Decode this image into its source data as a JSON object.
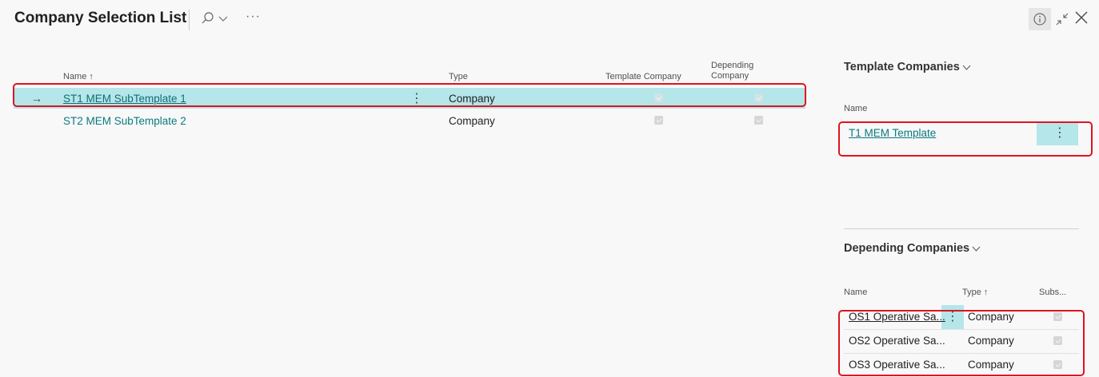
{
  "page": {
    "title": "Company Selection List",
    "icons": [
      "search-icon",
      "chevron-down-icon",
      "more-icon",
      "info-icon",
      "collapse-icon",
      "close-icon"
    ],
    "more_label": "···"
  },
  "colors": {
    "selection": "#b4e6ea",
    "link": "#0a7a80",
    "highlight_border": "#e0141e",
    "background": "#f8f8f8"
  },
  "main_list": {
    "columns": {
      "name": "Name",
      "name_sort": "↑",
      "type": "Type",
      "template_company": "Template Company",
      "depending_company_1": "Depending",
      "depending_company_2": "Company"
    },
    "rows": [
      {
        "name": "ST1 MEM SubTemplate 1",
        "type": "Company",
        "template_company": true,
        "depending_company": true,
        "selected": true
      },
      {
        "name": "ST2 MEM SubTemplate 2",
        "type": "Company",
        "template_company": true,
        "depending_company": true,
        "selected": false
      }
    ],
    "row_arrow": "→",
    "kebab": "⋮"
  },
  "template_companies": {
    "title": "Template Companies",
    "column_name": "Name",
    "rows": [
      {
        "name": "T1 MEM Template"
      }
    ],
    "kebab": "⋮"
  },
  "depending_companies": {
    "title": "Depending Companies",
    "columns": {
      "name": "Name",
      "type": "Type",
      "type_sort": "↑",
      "subs": "Subs..."
    },
    "rows": [
      {
        "name": "OS1 Operative Sa...",
        "type": "Company",
        "subs": true
      },
      {
        "name": "OS2 Operative Sa...",
        "type": "Company",
        "subs": true
      },
      {
        "name": "OS3 Operative Sa...",
        "type": "Company",
        "subs": true
      }
    ],
    "kebab": "⋮"
  }
}
